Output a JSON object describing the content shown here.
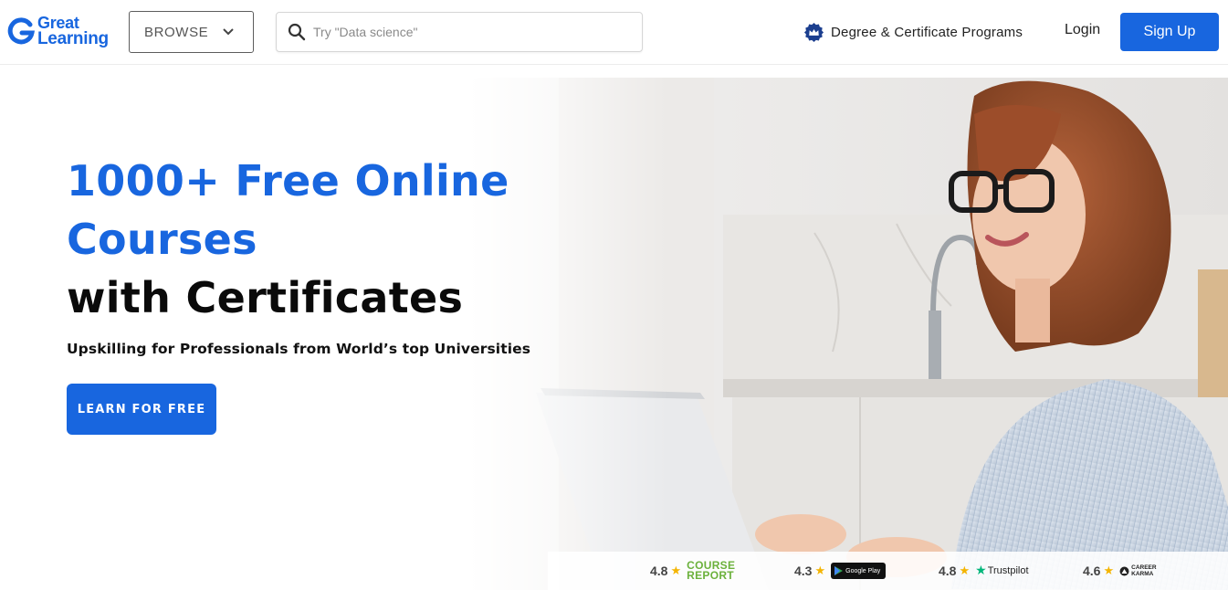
{
  "header": {
    "logo": {
      "line1": "Great",
      "line2": "Learning"
    },
    "browse_label": "BROWSE",
    "search": {
      "placeholder": "Try \"Data science\"",
      "value": ""
    },
    "programs_label": "Degree & Certificate Programs",
    "login_label": "Login",
    "signup_label": "Sign Up"
  },
  "hero": {
    "headline_line1": "1000+ Free Online",
    "headline_line2": "Courses",
    "headline_line3": "with Certificates",
    "subtitle": "Upskilling for Professionals from World’s top Universities",
    "cta_label": "LEARN FOR FREE"
  },
  "ratings": [
    {
      "value": "4.8",
      "source_line1": "COURSE",
      "source_line2": "REPORT"
    },
    {
      "value": "4.3",
      "source": "Google Play"
    },
    {
      "value": "4.8",
      "source": "Trustpilot"
    },
    {
      "value": "4.6",
      "source_line1": "CAREER",
      "source_line2": "KARMA"
    }
  ],
  "colors": {
    "brand": "#1866df",
    "text_dark": "#0a0a0a",
    "star": "#f4b400",
    "trustpilot": "#00b67a",
    "course_report": "#6bb13b"
  },
  "icons": [
    "great-learning-logo-icon",
    "chevron-down-icon",
    "search-icon",
    "crown-badge-icon",
    "star-icon",
    "google-play-icon",
    "trustpilot-star-icon",
    "career-karma-icon"
  ]
}
